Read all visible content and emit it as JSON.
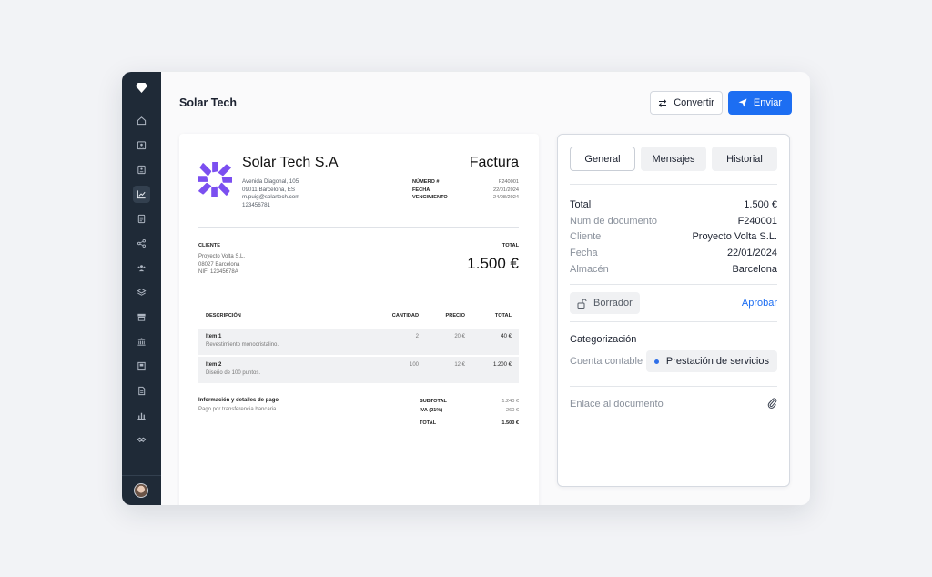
{
  "header": {
    "title": "Solar Tech"
  },
  "toolbar": {
    "convert_label": "Convertir",
    "send_label": "Enviar"
  },
  "sidebar": {
    "items": [
      {
        "icon": "home-icon"
      },
      {
        "icon": "contacts-icon"
      },
      {
        "icon": "id-card-icon"
      },
      {
        "icon": "chart-line-icon",
        "active": true
      },
      {
        "icon": "document-icon"
      },
      {
        "icon": "share-nodes-icon"
      },
      {
        "icon": "team-icon"
      },
      {
        "icon": "layers-icon"
      },
      {
        "icon": "cash-register-icon"
      },
      {
        "icon": "bank-icon"
      },
      {
        "icon": "ledger-icon"
      },
      {
        "icon": "file-icon"
      },
      {
        "icon": "bar-chart-icon"
      },
      {
        "icon": "handshake-icon"
      }
    ]
  },
  "invoice": {
    "company": "Solar Tech S.A",
    "address": [
      "Avenida Diagonal, 105",
      "09011 Barcelona, ES",
      "m.puig@solartech.com",
      "123456781"
    ],
    "doc_type": "Factura",
    "meta": [
      {
        "label": "NÚMERO #",
        "value": "F240001"
      },
      {
        "label": "FECHA",
        "value": "22/01/2024"
      },
      {
        "label": "VENCIMIENTO",
        "value": "24/08/2024"
      }
    ],
    "client_label": "CLIENTE",
    "client": [
      "Proyecto Volta S.L.",
      "08027 Barcelona",
      "NIF: 12345678A"
    ],
    "total_label": "TOTAL",
    "total": "1.500 €",
    "columns": {
      "desc": "DESCRIPCIÓN",
      "qty": "CANTIDAD",
      "price": "PRECIO",
      "total": "TOTAL"
    },
    "items": [
      {
        "name": "Item 1",
        "desc": "Revestimiento monocristalino.",
        "qty": "2",
        "price": "20 €",
        "total": "40 €"
      },
      {
        "name": "Item 2",
        "desc": "Diseño de 100 puntos.",
        "qty": "100",
        "price": "12 €",
        "total": "1.200 €"
      }
    ],
    "payment_title": "Información y detalles de pago",
    "payment_desc": "Pago por transferencia bancaria.",
    "summary": [
      {
        "label": "SUBTOTAL",
        "value": "1.240 €"
      },
      {
        "label": "IVA (21%)",
        "value": "260 €"
      }
    ],
    "grand": {
      "label": "TOTAL",
      "value": "1.500 €"
    }
  },
  "panel": {
    "tabs": [
      {
        "label": "General",
        "active": true
      },
      {
        "label": "Mensajes"
      },
      {
        "label": "Historial"
      }
    ],
    "details": [
      {
        "label": "Total",
        "value": "1.500 €"
      },
      {
        "label": "Num de documento",
        "value": "F240001"
      },
      {
        "label": "Cliente",
        "value": "Proyecto Volta S.L."
      },
      {
        "label": "Fecha",
        "value": "22/01/2024"
      },
      {
        "label": "Almacén",
        "value": "Barcelona"
      }
    ],
    "status": "Borrador",
    "approve": "Aprobar",
    "categorization_title": "Categorización",
    "account_label": "Cuenta contable",
    "account_value": "Prestación de servicios",
    "link_label": "Enlace al documento"
  },
  "colors": {
    "accent": "#1d6ef2",
    "sidebar": "#1f2a37",
    "logo": "#7b4ff0"
  }
}
